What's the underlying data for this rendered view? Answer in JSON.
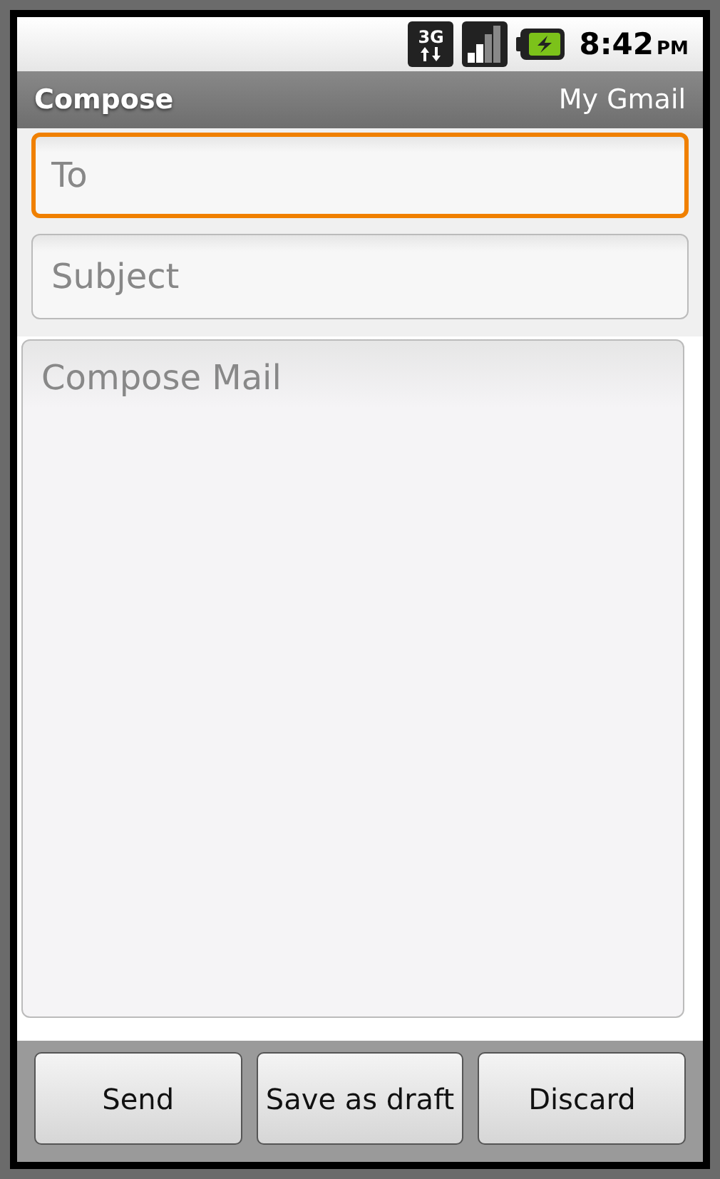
{
  "status_bar": {
    "network": "3G",
    "time": "8:42",
    "ampm": "PM"
  },
  "title_bar": {
    "title": "Compose",
    "account": "My Gmail"
  },
  "fields": [
    {
      "placeholder": "To",
      "focused": true
    },
    {
      "placeholder": "Subject",
      "focused": false
    }
  ],
  "body": {
    "placeholder": "Compose Mail"
  },
  "buttons": [
    "Send",
    "Save as draft",
    "Discard"
  ]
}
